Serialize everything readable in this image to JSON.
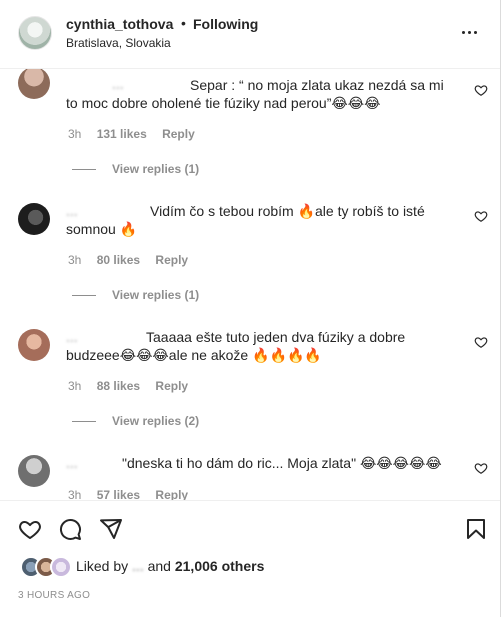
{
  "header": {
    "username": "cynthia_tothova",
    "separator": "•",
    "follow_status": "Following",
    "location": "Bratislava, Slovakia"
  },
  "comments": [
    {
      "author": "...",
      "text": "Separ : “ no moja zlata ukaz nezdá sa mi to moc dobre oholené tie fúziky nad perou”😂😂😂",
      "time": "3h",
      "likes": "131 likes",
      "reply": "Reply",
      "replies": "View replies (1)"
    },
    {
      "author": "...",
      "text": "Vidím čo s tebou robím 🔥ale ty robíš to isté somnou 🔥",
      "time": "3h",
      "likes": "80 likes",
      "reply": "Reply",
      "replies": "View replies (1)"
    },
    {
      "author": "...",
      "text": "Taaaaa ešte tuto jeden dva fúziky a dobre budzeee😂😂😂ale ne akože 🔥🔥🔥🔥",
      "time": "3h",
      "likes": "88 likes",
      "reply": "Reply",
      "replies": "View replies (2)"
    },
    {
      "author": "...",
      "text": "\"dneska ti ho dám do ric... Moja zlata\" 😂😂😂😂😂",
      "time": "3h",
      "likes": "57 likes",
      "reply": "Reply"
    }
  ],
  "footer": {
    "liked_prefix": "Liked by",
    "liked_user": "...",
    "liked_middle": "and",
    "liked_others": "21,006 others",
    "time_ago": "3 HOURS AGO"
  },
  "icons": {
    "more": "more-icon",
    "heart": "heart-icon",
    "comment": "comment-icon",
    "share": "share-icon",
    "save": "bookmark-icon"
  },
  "colors": {
    "text": "#262626",
    "secondary": "#8e8e8e",
    "border": "#efefef"
  }
}
